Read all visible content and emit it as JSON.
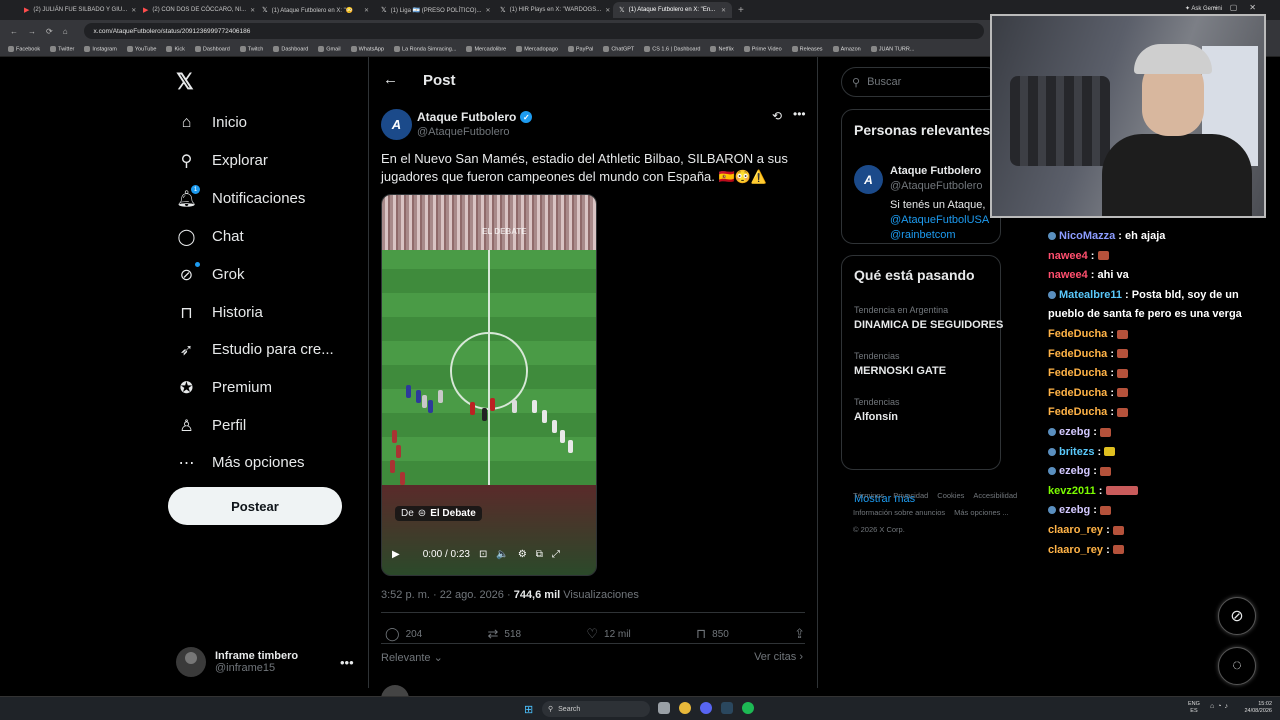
{
  "browser": {
    "tabs": [
      {
        "label": "(2) JULIÁN FUE SILBADO Y GIU...",
        "icon": "youtube-icon",
        "active": false
      },
      {
        "label": "(2) CON DOS DE CÓCCARO, NI...",
        "icon": "youtube-icon",
        "active": false
      },
      {
        "label": "(1) Ataque Futbolero en X: \"😳",
        "icon": "x-icon",
        "active": false
      },
      {
        "label": "(1) Liga 🇦🇷 (PRESO POLÍTICO)...",
        "icon": "x-icon",
        "active": false
      },
      {
        "label": "(1) HIR Plays en X: \"WARDOGS...",
        "icon": "x-icon",
        "active": false
      },
      {
        "label": "(1) Ataque Futbolero en X: \"En...",
        "icon": "x-icon",
        "active": true
      }
    ],
    "ask_gemini": "Ask Gemini",
    "url": "x.com/AtaqueFutbolero/status/2091236999772406186",
    "bookmarks": [
      "Facebook",
      "Twitter",
      "Instagram",
      "YouTube",
      "Kick",
      "Dashboard",
      "Twitch",
      "Dashboard",
      "Gmail",
      "WhatsApp",
      "La Ronda Simracing...",
      "Mercadolibre",
      "Mercadopago",
      "PayPal",
      "ChatGPT",
      "CS 1.6 | Dashboard",
      "Netflix",
      "Prime Video",
      "Releases",
      "Amazon",
      "JUAN TURR..."
    ]
  },
  "sidebar": {
    "items": [
      {
        "label": "Inicio",
        "icon": "home-icon"
      },
      {
        "label": "Explorar",
        "icon": "search-icon"
      },
      {
        "label": "Notificaciones",
        "icon": "bell-icon",
        "badge": "1"
      },
      {
        "label": "Chat",
        "icon": "chat-icon"
      },
      {
        "label": "Grok",
        "icon": "grok-icon"
      },
      {
        "label": "Historia",
        "icon": "bookmark-icon"
      },
      {
        "label": "Estudio para cre...",
        "icon": "rocket-icon"
      },
      {
        "label": "Premium",
        "icon": "verified-icon"
      },
      {
        "label": "Perfil",
        "icon": "person-icon"
      },
      {
        "label": "Más opciones",
        "icon": "more-circle-icon"
      }
    ],
    "post_button": "Postear",
    "account": {
      "name": "Inframe timbero",
      "handle": "@inframe15"
    }
  },
  "post": {
    "header": "Post",
    "author": {
      "name": "Ataque Futbolero",
      "handle": "@AtaqueFutbolero",
      "avatar_letter": "A"
    },
    "text": "En el Nuevo San Mamés, estadio del Athletic Bilbao, SILBARON a sus jugadores que fueron campeones del mundo con España. 🇪🇸😳⚠️",
    "video": {
      "from_label": "De",
      "source": "El Debate",
      "time": "0:00 / 0:23",
      "crowd_text": "EL DEBATE"
    },
    "timestamp": "3:52 p. m. · 22 ago. 2026 · ",
    "views_count": "744,6 mil",
    "views_label": " Visualizaciones",
    "stats": {
      "replies": "204",
      "reposts": "518",
      "likes": "12 mil",
      "bookmarks": "850"
    },
    "relevant_label": "Relevante",
    "quotes_label": "Ver citas"
  },
  "right": {
    "search_placeholder": "Buscar",
    "relevant_title": "Personas relevantes",
    "relevant_person": {
      "name": "Ataque Futbolero",
      "handle": "@AtaqueFutbolero",
      "bio_1": "Si tenés un Ataque,",
      "bio_2": "@AtaqueFutbolUSA",
      "bio_3": "@rainbetcom"
    },
    "trends_title": "Qué está pasando",
    "trends": [
      {
        "meta": "Tendencia en Argentina",
        "name": "DINAMICA DE SEGUIDORES"
      },
      {
        "meta": "Tendencias",
        "name": "MERNOSKI GATE"
      },
      {
        "meta": "Tendencias",
        "name": "Alfonsín"
      }
    ],
    "show_more": "Mostrar más",
    "footer": [
      "Términos",
      "Privacidad",
      "Cookies",
      "Accesibilidad",
      "Información sobre anuncios",
      "Más opciones ...",
      "© 2026 X Corp."
    ]
  },
  "stream_chat": [
    {
      "user": "NicoMazza",
      "msg": "eh ajaja",
      "color": "u1",
      "badge": true
    },
    {
      "user": "nawee4",
      "msg": "",
      "color": "u2",
      "emote": "brick"
    },
    {
      "user": "nawee4",
      "msg": "ahi va",
      "color": "u2"
    },
    {
      "user": "Matealbre11",
      "msg": "Posta bld, soy de un",
      "msg2": "pueblo de santa fe pero es una verga",
      "color": "u4",
      "badge": true
    },
    {
      "user": "FedeDucha",
      "msg": "",
      "color": "u3",
      "emote": "brick"
    },
    {
      "user": "FedeDucha",
      "msg": "",
      "color": "u3",
      "emote": "brick"
    },
    {
      "user": "FedeDucha",
      "msg": "",
      "color": "u3",
      "emote": "brick"
    },
    {
      "user": "FedeDucha",
      "msg": "",
      "color": "u3",
      "emote": "brick"
    },
    {
      "user": "FedeDucha",
      "msg": "",
      "color": "u3",
      "emote": "brick"
    },
    {
      "user": "ezebg",
      "msg": "",
      "color": "u6",
      "emote": "brick",
      "badge": true
    },
    {
      "user": "britezs",
      "msg": "",
      "color": "u4",
      "emote": "yellow",
      "badge": true
    },
    {
      "user": "ezebg",
      "msg": "",
      "color": "u6",
      "emote": "brick",
      "badge": true
    },
    {
      "user": "kevz2011",
      "msg": "",
      "color": "u5",
      "emote": "wide"
    },
    {
      "user": "ezebg",
      "msg": "",
      "color": "u6",
      "emote": "brick",
      "badge": true
    },
    {
      "user": "claaro_rey",
      "msg": "",
      "color": "u3",
      "emote": "brick"
    },
    {
      "user": "claaro_rey",
      "msg": "",
      "color": "u3",
      "emote": "brick"
    }
  ],
  "taskbar": {
    "search": "Search",
    "lang": "ENG",
    "region": "ES",
    "time": "15:02",
    "date": "24/08/2026"
  },
  "colors": {
    "accent": "#1d9bf0",
    "background": "#000000",
    "text": "#e7e9ea",
    "muted": "#71767b"
  }
}
